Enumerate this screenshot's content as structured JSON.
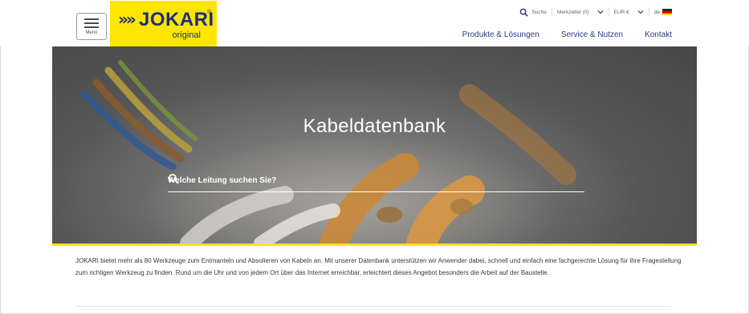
{
  "header": {
    "menu_label": "Menü",
    "logo": {
      "chevrons": "»»",
      "word": "JOKARI",
      "reg": "®",
      "sub": "original"
    },
    "utility": {
      "search_label": "Suche",
      "notepad_label": "Merkzettel (0)",
      "currency_label": "EUR €",
      "language_label": "de"
    },
    "nav": [
      "Produkte & Lösungen",
      "Service & Nutzen",
      "Kontakt"
    ]
  },
  "hero": {
    "title": "Kabeldatenbank",
    "search_placeholder": "Welche Leitung suchen Sie?"
  },
  "intro_text": "JOKARI bietet mehr als 80 Werkzeuge zum Entmanteln und Absolieren von Kabeln an. Mit unserer Datenbank unterstützen wir Anwender dabei, schnell und einfach eine fachgerechte Lösung für ihre Fragestellung zum richtigen Werkzeug zu finden. Rund um die Uhr und von jedem Ort über das Internet erreichbar, erleichtert dieses Angebot besonders die Arbeit auf der Baustelle.",
  "colors": {
    "brand_yellow": "#ffe600",
    "brand_blue": "#1c2f7a",
    "nav_text": "#2a3b7f"
  }
}
